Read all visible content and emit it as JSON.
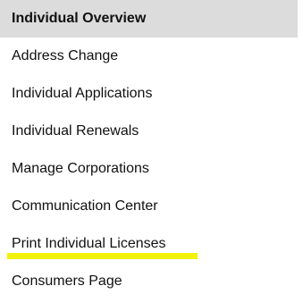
{
  "menu": {
    "items": [
      {
        "label": "Individual Overview",
        "active": true
      },
      {
        "label": "Address Change"
      },
      {
        "label": "Individual Applications"
      },
      {
        "label": "Individual Renewals"
      },
      {
        "label": "Manage Corporations"
      },
      {
        "label": "Communication Center"
      },
      {
        "label": "Print Individual Licenses",
        "highlighted": true
      },
      {
        "label": "Consumers Page"
      }
    ],
    "active_background": "#dcdcdc",
    "highlight_color": "#f2f20a"
  }
}
